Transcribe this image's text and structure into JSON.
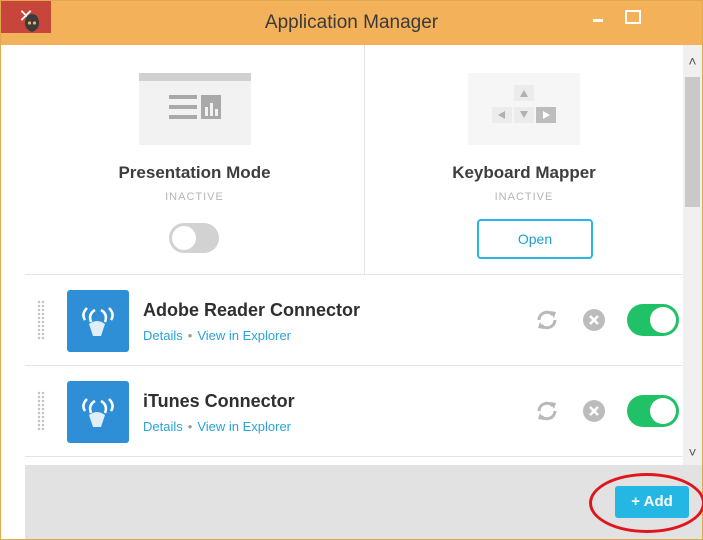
{
  "window": {
    "title": "Application Manager",
    "close_glyph": "✕"
  },
  "features": [
    {
      "title": "Presentation Mode",
      "status": "INACTIVE",
      "control": "toggle-off"
    },
    {
      "title": "Keyboard Mapper",
      "status": "INACTIVE",
      "button_label": "Open"
    }
  ],
  "connectors": [
    {
      "name": "Adobe Reader Connector",
      "details_label": "Details",
      "separator": "•",
      "explorer_label": "View in Explorer",
      "enabled": true
    },
    {
      "name": "iTunes Connector",
      "details_label": "Details",
      "separator": "•",
      "explorer_label": "View in Explorer",
      "enabled": true
    }
  ],
  "scrollbar": {
    "up_glyph": "˄",
    "down_glyph": "˅"
  },
  "footer": {
    "add_label": "+ Add"
  },
  "colors": {
    "titlebar": "#f3b25a",
    "close": "#c8453c",
    "accent": "#25b7e4",
    "toggle_on": "#21c167",
    "link": "#2aa3d6",
    "highlight_ring": "#e0161e"
  },
  "icons": {
    "app": "app-logo-icon",
    "presentation": "presentation-mode-icon",
    "keyboard": "keyboard-arrows-icon",
    "connector": "connector-wave-icon",
    "refresh": "refresh-icon",
    "remove": "remove-icon",
    "drag": "drag-handle-icon"
  }
}
